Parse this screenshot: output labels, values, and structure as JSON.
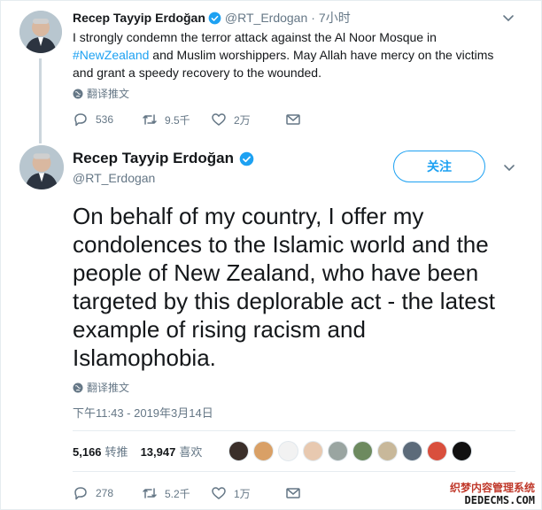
{
  "tweet1": {
    "name": "Recep Tayyip Erdoğan",
    "handle": "@RT_Erdogan",
    "separator": "·",
    "time": "7小时",
    "text_before": "I strongly condemn the terror attack against the Al Noor Mosque in ",
    "hashtag": "#NewZealand",
    "text_after": " and Muslim worshippers. May Allah have mercy on the victims and grant a speedy recovery to the wounded.",
    "translate": "翻译推文",
    "replies": "536",
    "retweets": "9.5千",
    "likes": "2万"
  },
  "tweet2": {
    "name": "Recep Tayyip Erdoğan",
    "handle": "@RT_Erdogan",
    "follow_label": "关注",
    "text": "On behalf of my country, I offer my condolences to the Islamic world and the people of New Zealand, who have been targeted by this deplorable act - the latest example of rising racism and Islamophobia.",
    "translate": "翻译推文",
    "timestamp": "下午11:43 - 2019年3月14日",
    "retweet_count": "5,166",
    "retweet_label": "转推",
    "like_count": "13,947",
    "like_label": "喜欢",
    "replies": "278",
    "retweets": "5.2千",
    "likes": "1万"
  },
  "liker_avatar_colors": [
    "#3b2f2a",
    "#d9a066",
    "#f2f2f2",
    "#e8c9b0",
    "#9aa5a1",
    "#6d8a5f",
    "#c8b89a",
    "#5c6b7a",
    "#d94f3d",
    "#111111"
  ],
  "watermark": {
    "line1": "织梦内容管理系统",
    "line2": "DEDECMS.COM"
  },
  "colors": {
    "accent": "#1da1f2",
    "muted": "#657786",
    "text": "#14171a"
  },
  "icons": [
    "verified-badge-icon",
    "chevron-down-icon",
    "globe-icon",
    "reply-icon",
    "retweet-icon",
    "like-icon",
    "message-icon"
  ]
}
